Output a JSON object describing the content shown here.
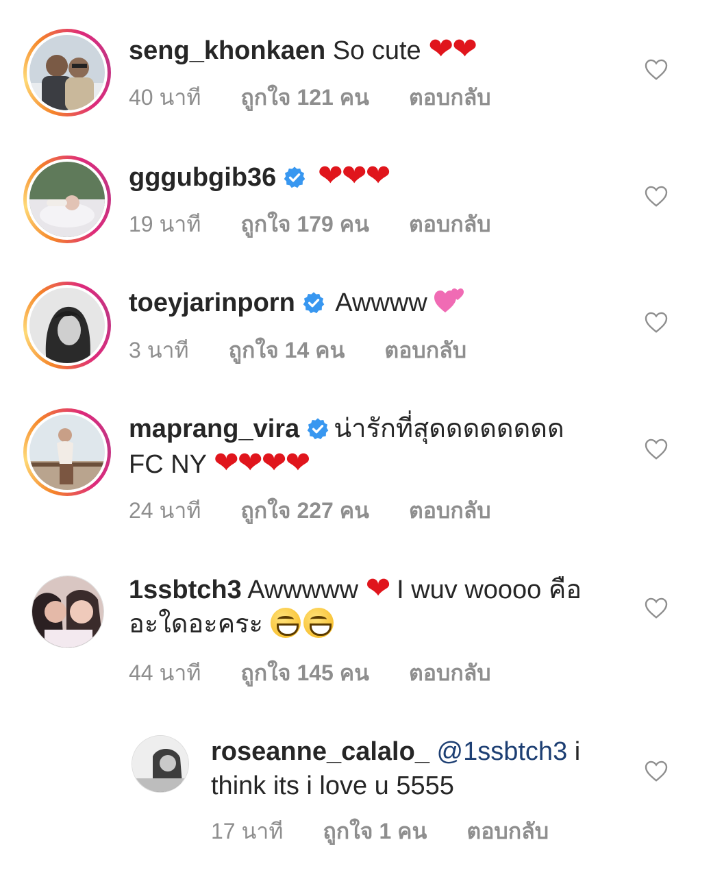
{
  "comments": [
    {
      "username": "seng_khonkaen",
      "text": "So cute",
      "emoji": "❤❤",
      "time": "40 นาที",
      "likes": "ถูกใจ 121 คน",
      "reply": "ตอบกลับ"
    },
    {
      "username": "gggubgib36",
      "verified": true,
      "emoji": "❤❤❤",
      "time": "19 นาที",
      "likes": "ถูกใจ 179 คน",
      "reply": "ตอบกลับ"
    },
    {
      "username": "toeyjarinporn",
      "verified": true,
      "text": "Awwww",
      "time": "3 นาที",
      "likes": "ถูกใจ 14 คน",
      "reply": "ตอบกลับ"
    },
    {
      "username": "maprang_vira",
      "verified": true,
      "text": "น่ารักที่สุดดดดดดดด",
      "text2": "FC NY",
      "emoji": "❤❤❤❤",
      "time": "24 นาที",
      "likes": "ถูกใจ 227 คน",
      "reply": "ตอบกลับ"
    },
    {
      "username": "1ssbtch3",
      "text": "Awwwww",
      "text_after": "I wuv woooo คือ",
      "text2": "อะใดอะคระ",
      "emoji": "❤",
      "time": "44 นาที",
      "likes": "ถูกใจ 145 คน",
      "reply": "ตอบกลับ"
    },
    {
      "username": "roseanne_calalo_",
      "mention": "@1ssbtch3",
      "text": "i",
      "text2": "think its i love u 5555",
      "time": "17 นาที",
      "likes": "ถูกใจ 1 คน",
      "reply": "ตอบกลับ"
    }
  ],
  "colors": {
    "text": "#262626",
    "meta": "#8e8e8e",
    "verified": "#3897f0",
    "heart": "#e0151c",
    "mention": "#1d3f73"
  },
  "icons": {
    "like": "heart-outline-icon",
    "verified": "verified-badge-icon"
  }
}
